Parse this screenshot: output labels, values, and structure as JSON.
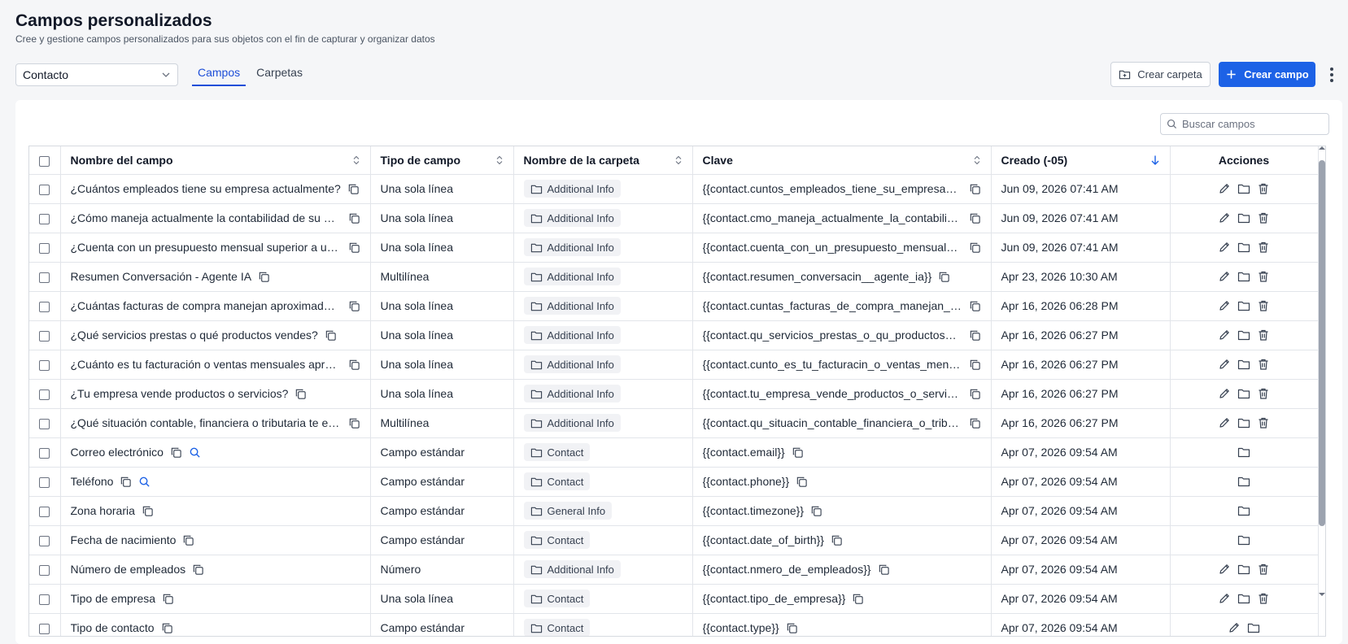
{
  "header": {
    "title": "Campos personalizados",
    "subtitle": "Cree y gestione campos personalizados para sus objetos con el fin de capturar y organizar datos"
  },
  "toolbar": {
    "object_select": "Contacto",
    "tabs": [
      {
        "label": "Campos",
        "active": true
      },
      {
        "label": "Carpetas",
        "active": false
      }
    ],
    "create_folder_label": "Crear carpeta",
    "create_field_label": "Crear campo",
    "search_placeholder": "Buscar campos"
  },
  "colors": {
    "accent": "#1d62e6",
    "tab_active": "#1d4ed8",
    "search_icon": "#1d62e6"
  },
  "table": {
    "columns": [
      "Nombre del campo",
      "Tipo de campo",
      "Nombre de la carpeta",
      "Clave",
      "Creado (-05)",
      "Acciones"
    ],
    "rows": [
      {
        "name": "¿Cuántos empleados tiene su empresa actualmente?",
        "type": "Una sola línea",
        "folder": "Additional Info",
        "key": "{{contact.cuntos_empleados_tiene_su_empresa_act...",
        "created": "Jun 09, 2026 07:41 AM",
        "search": false,
        "actions": [
          "edit-icon",
          "folder-icon",
          "trash-icon"
        ]
      },
      {
        "name": "¿Cómo maneja actualmente la contabilidad de su em...",
        "type": "Una sola línea",
        "folder": "Additional Info",
        "key": "{{contact.cmo_maneja_actualmente_la_contabilidad...",
        "created": "Jun 09, 2026 07:41 AM",
        "search": false,
        "actions": [
          "edit-icon",
          "folder-icon",
          "trash-icon"
        ]
      },
      {
        "name": "¿Cuenta con un presupuesto mensual superior a un sa...",
        "type": "Una sola línea",
        "folder": "Additional Info",
        "key": "{{contact.cuenta_con_un_presupuesto_mensual_sup...",
        "created": "Jun 09, 2026 07:41 AM",
        "search": false,
        "actions": [
          "edit-icon",
          "folder-icon",
          "trash-icon"
        ]
      },
      {
        "name": "Resumen Conversación - Agente IA",
        "type": "Multilínea",
        "folder": "Additional Info",
        "key": "{{contact.resumen_conversacin__agente_ia}}",
        "created": "Apr 23, 2026 10:30 AM",
        "search": false,
        "actions": [
          "edit-icon",
          "folder-icon",
          "trash-icon"
        ]
      },
      {
        "name": "¿Cuántas facturas de compra manejan aproximadame...",
        "type": "Una sola línea",
        "folder": "Additional Info",
        "key": "{{contact.cuntas_facturas_de_compra_manejan_apr...",
        "created": "Apr 16, 2026 06:28 PM",
        "search": false,
        "actions": [
          "edit-icon",
          "folder-icon",
          "trash-icon"
        ]
      },
      {
        "name": "¿Qué servicios prestas o qué productos vendes?",
        "type": "Una sola línea",
        "folder": "Additional Info",
        "key": "{{contact.qu_servicios_prestas_o_qu_productos_ven...",
        "created": "Apr 16, 2026 06:27 PM",
        "search": false,
        "actions": [
          "edit-icon",
          "folder-icon",
          "trash-icon"
        ]
      },
      {
        "name": "¿Cuánto es tu facturación o ventas mensuales aproxi...",
        "type": "Una sola línea",
        "folder": "Additional Info",
        "key": "{{contact.cunto_es_tu_facturacin_o_ventas_mensual...",
        "created": "Apr 16, 2026 06:27 PM",
        "search": false,
        "actions": [
          "edit-icon",
          "folder-icon",
          "trash-icon"
        ]
      },
      {
        "name": "¿Tu empresa vende productos o servicios?",
        "type": "Una sola línea",
        "folder": "Additional Info",
        "key": "{{contact.tu_empresa_vende_productos_o_servicios}}",
        "created": "Apr 16, 2026 06:27 PM",
        "search": false,
        "actions": [
          "edit-icon",
          "folder-icon",
          "trash-icon"
        ]
      },
      {
        "name": "¿Qué situación contable, financiera o tributaria te está...",
        "type": "Multilínea",
        "folder": "Additional Info",
        "key": "{{contact.qu_situacin_contable_financiera_o_tributa...",
        "created": "Apr 16, 2026 06:27 PM",
        "search": false,
        "actions": [
          "edit-icon",
          "folder-icon",
          "trash-icon"
        ]
      },
      {
        "name": "Correo electrónico",
        "type": "Campo estándar",
        "folder": "Contact",
        "key": "{{contact.email}}",
        "created": "Apr 07, 2026 09:54 AM",
        "search": true,
        "actions": [
          "folder-icon"
        ]
      },
      {
        "name": "Teléfono",
        "type": "Campo estándar",
        "folder": "Contact",
        "key": "{{contact.phone}}",
        "created": "Apr 07, 2026 09:54 AM",
        "search": true,
        "actions": [
          "folder-icon"
        ]
      },
      {
        "name": "Zona horaria",
        "type": "Campo estándar",
        "folder": "General Info",
        "key": "{{contact.timezone}}",
        "created": "Apr 07, 2026 09:54 AM",
        "search": false,
        "actions": [
          "folder-icon"
        ]
      },
      {
        "name": "Fecha de nacimiento",
        "type": "Campo estándar",
        "folder": "Contact",
        "key": "{{contact.date_of_birth}}",
        "created": "Apr 07, 2026 09:54 AM",
        "search": false,
        "actions": [
          "folder-icon"
        ]
      },
      {
        "name": "Número de empleados",
        "type": "Número",
        "folder": "Additional Info",
        "key": "{{contact.nmero_de_empleados}}",
        "created": "Apr 07, 2026 09:54 AM",
        "search": false,
        "actions": [
          "edit-icon",
          "folder-icon",
          "trash-icon"
        ]
      },
      {
        "name": "Tipo de empresa",
        "type": "Una sola línea",
        "folder": "Contact",
        "key": "{{contact.tipo_de_empresa}}",
        "created": "Apr 07, 2026 09:54 AM",
        "search": false,
        "actions": [
          "edit-icon",
          "folder-icon",
          "trash-icon"
        ]
      },
      {
        "name": "Tipo de contacto",
        "type": "Campo estándar",
        "folder": "Contact",
        "key": "{{contact.type}}",
        "created": "Apr 07, 2026 09:54 AM",
        "search": false,
        "actions": [
          "edit-icon",
          "folder-icon"
        ]
      }
    ]
  }
}
